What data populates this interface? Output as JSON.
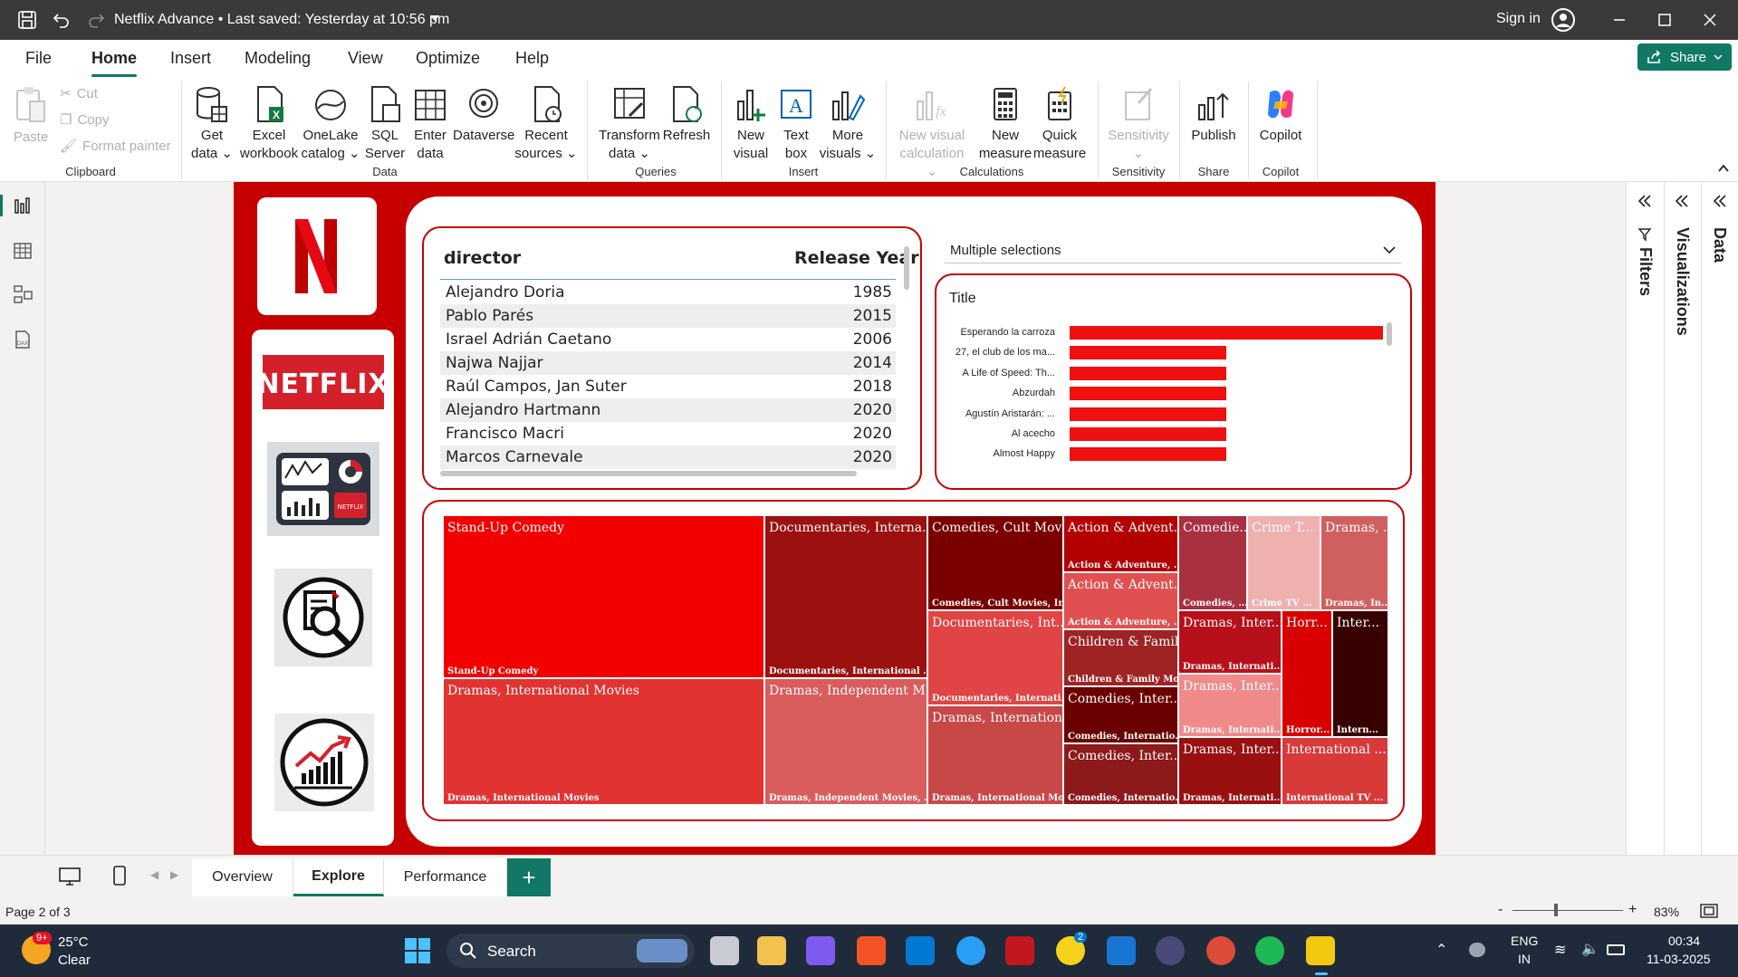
{
  "titlebar": {
    "title": "Netflix Advance  •  Last saved: Yesterday at 10:56 pm",
    "sign_in": "Sign in"
  },
  "menu": {
    "tabs": [
      "File",
      "Home",
      "Insert",
      "Modeling",
      "View",
      "Optimize",
      "Help"
    ],
    "active": "Home",
    "share": "Share"
  },
  "ribbon": {
    "clipboard": {
      "paste": "Paste",
      "cut": "Cut",
      "copy": "Copy",
      "format_painter": "Format painter",
      "group": "Clipboard"
    },
    "data": {
      "get_data": [
        "Get",
        "data"
      ],
      "excel": [
        "Excel",
        "workbook"
      ],
      "onelake": [
        "OneLake",
        "catalog"
      ],
      "sql": [
        "SQL",
        "Server"
      ],
      "enter": [
        "Enter",
        "data"
      ],
      "dataverse": [
        "Dataverse",
        ""
      ],
      "recent": [
        "Recent",
        "sources"
      ],
      "group": "Data"
    },
    "queries": {
      "transform": [
        "Transform",
        "data"
      ],
      "refresh": [
        "Refresh",
        ""
      ],
      "group": "Queries"
    },
    "insert": {
      "new_visual": [
        "New",
        "visual"
      ],
      "text_box": [
        "Text",
        "box"
      ],
      "more_visuals": [
        "More",
        "visuals"
      ],
      "group": "Insert"
    },
    "calculations": {
      "new_visual_calc": [
        "New visual",
        "calculation"
      ],
      "new_measure": [
        "New",
        "measure"
      ],
      "quick_measure": [
        "Quick",
        "measure"
      ],
      "group": "Calculations"
    },
    "sensitivity": {
      "label": "Sensitivity",
      "group": "Sensitivity"
    },
    "share": {
      "publish": "Publish",
      "group": "Share"
    },
    "copilot": {
      "label": "Copilot",
      "group": "Copilot"
    }
  },
  "table": {
    "headers": [
      "director",
      "Release Year"
    ],
    "rows": [
      {
        "director": "Alejandro Doria",
        "year": "1985"
      },
      {
        "director": "Pablo Parés",
        "year": "2015"
      },
      {
        "director": "Israel Adrián Caetano",
        "year": "2006"
      },
      {
        "director": "Najwa Najjar",
        "year": "2014"
      },
      {
        "director": "Raúl Campos, Jan Suter",
        "year": "2018"
      },
      {
        "director": "Alejandro Hartmann",
        "year": "2020"
      },
      {
        "director": "Francisco Macri",
        "year": "2020"
      },
      {
        "director": "Marcos Carnevale",
        "year": "2020"
      }
    ]
  },
  "slicer": {
    "value": "Multiple selections"
  },
  "bar_visual": {
    "title": "Title",
    "bars": [
      {
        "label": "Esperando la carroza",
        "value": 2
      },
      {
        "label": "27, el club de los ma...",
        "value": 1
      },
      {
        "label": "A Life of Speed: Th...",
        "value": 1
      },
      {
        "label": "Abzurdah",
        "value": 1
      },
      {
        "label": "Agustín Aristarán: ...",
        "value": 1
      },
      {
        "label": "Al acecho",
        "value": 1
      },
      {
        "label": "Almost Happy",
        "value": 1
      }
    ]
  },
  "treemap": {
    "tiles": [
      {
        "t": "Stand-Up Comedy",
        "b": "Stand-Up Comedy",
        "c": "#f20000"
      },
      {
        "t": "Dramas, International Movies",
        "b": "Dramas, International Movies",
        "c": "#e23333"
      },
      {
        "t": "Documentaries, Interna...",
        "b": "Documentaries, International ...",
        "c": "#9c1010"
      },
      {
        "t": "Dramas, Independent M...",
        "b": "Dramas, Independent Movies, ...",
        "c": "#d95d5d"
      },
      {
        "t": "Comedies, Cult Movi...",
        "b": "Comedies, Cult Movies, In...",
        "c": "#7a0000"
      },
      {
        "t": "Documentaries, Int...",
        "b": "Documentaries, Internati...",
        "c": "#e04444"
      },
      {
        "t": "Dramas, Internation...",
        "b": "Dramas, International Mo...",
        "c": "#c84848"
      },
      {
        "t": "Action & Advent...",
        "b": "Action & Adventure, ...",
        "c": "#b30000"
      },
      {
        "t": "Action & Advent...",
        "b": "Action & Adventure, ...",
        "c": "#e05050"
      },
      {
        "t": "Children & Famil...",
        "b": "Children & Family Mo...",
        "c": "#9e2323"
      },
      {
        "t": "Comedies, Inter...",
        "b": "Comedies, Internatio...",
        "c": "#6a0000"
      },
      {
        "t": "Comedies, Inter...",
        "b": "Comedies, Internatio...",
        "c": "#8c1a1a"
      },
      {
        "t": "Comedie...",
        "b": "Comedies, ...",
        "c": "#a83040"
      },
      {
        "t": "Crime T...",
        "b": "Crime TV ...",
        "c": "#efb0b0"
      },
      {
        "t": "Dramas, ...",
        "b": "Dramas, In...",
        "c": "#d06060"
      },
      {
        "t": "Dramas, Inter...",
        "b": "Dramas, Internati...",
        "c": "#b8101a"
      },
      {
        "t": "Dramas, Inter...",
        "b": "Dramas, Internati...",
        "c": "#f08a8a"
      },
      {
        "t": "Dramas, Inter...",
        "b": "Dramas, Internati...",
        "c": "#9a1010"
      },
      {
        "t": "Horr...",
        "b": "Horror...",
        "c": "#d80000"
      },
      {
        "t": "Inter...",
        "b": "Intern...",
        "c": "#380000"
      },
      {
        "t": "International ...",
        "b": "International TV ...",
        "c": "#d83a3a"
      }
    ]
  },
  "panes": {
    "filters": "Filters",
    "visualizations": "Visualizations",
    "data": "Data"
  },
  "pages": {
    "tabs": [
      "Overview",
      "Explore",
      "Performance"
    ],
    "active": "Explore",
    "add": "+"
  },
  "status": {
    "page": "Page 2 of 3",
    "zoom": "83%"
  },
  "taskbar": {
    "weather_temp": "25°C",
    "weather_desc": "Clear",
    "weather_badge": "9+",
    "search": "Search",
    "lang": "ENG",
    "region": "IN",
    "time": "00:34",
    "date": "11-03-2025",
    "badge_count": "2"
  },
  "colors": {
    "brand_red": "#c60000",
    "accent": "#117865"
  }
}
